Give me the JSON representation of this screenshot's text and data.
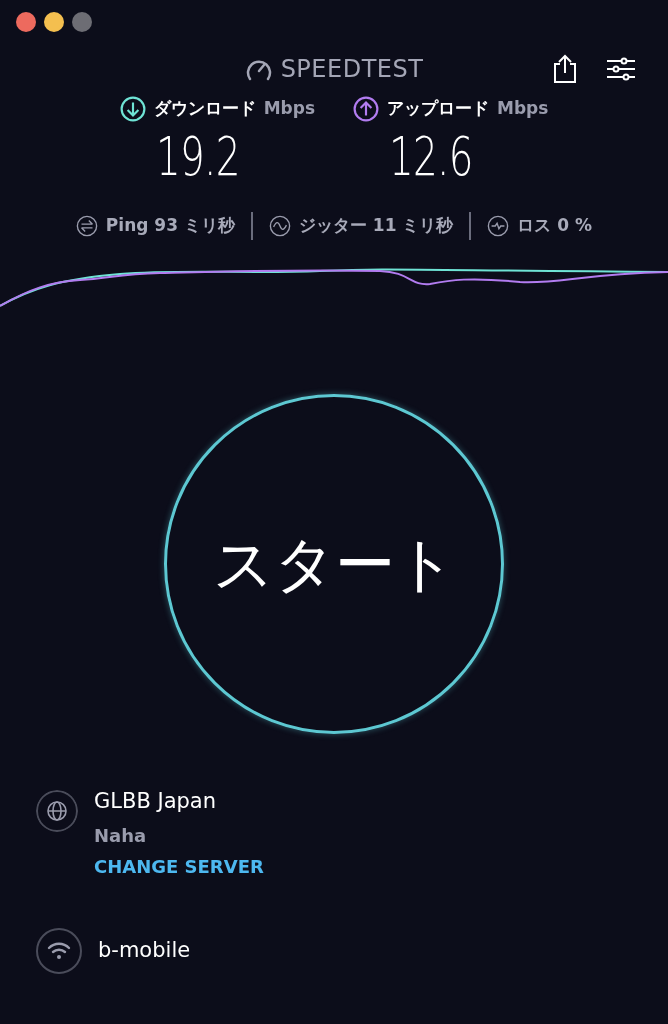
{
  "header": {
    "logo": "SPEEDTEST"
  },
  "speeds": [
    {
      "kind": "download",
      "label": "ダウンロード",
      "unit": "Mbps",
      "value": "19.2",
      "color": "#6fe3d5"
    },
    {
      "kind": "upload",
      "label": "アップロード",
      "unit": "Mbps",
      "value": "12.6",
      "color": "#b27cf0"
    }
  ],
  "stats": [
    {
      "kind": "ping",
      "label": "Ping",
      "value": "93",
      "unit": "ミリ秒"
    },
    {
      "kind": "jitter",
      "label": "ジッター",
      "value": "11",
      "unit": "ミリ秒"
    },
    {
      "kind": "loss",
      "label": "ロス",
      "value": "0",
      "unit": "%"
    }
  ],
  "start_button": {
    "label": "スタート"
  },
  "server": {
    "name": "GLBB Japan",
    "location": "Naha",
    "action": "CHANGE SERVER"
  },
  "network": {
    "name": "b-mobile"
  }
}
